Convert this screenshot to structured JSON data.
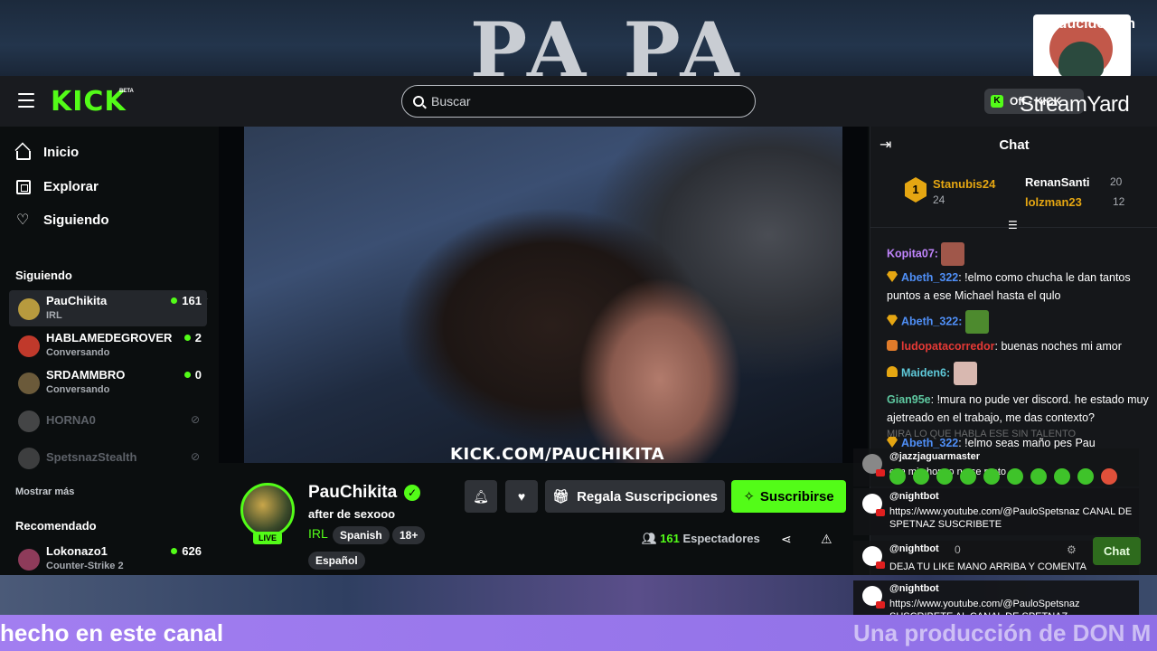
{
  "overlay": {
    "banner_text": "PA PA",
    "produced_by": "Producido con",
    "streamyard_logo": "StreamYard",
    "ticker_left": "hecho en este canal",
    "ticker_right": "Una producción de DON M"
  },
  "header": {
    "logo": "KICK",
    "logo_badge": "BETA",
    "search_placeholder": "Buscar",
    "offkick_label": "Off - KICK"
  },
  "sidebar": {
    "nav": [
      {
        "label": "Inicio",
        "icon": "home-icon"
      },
      {
        "label": "Explorar",
        "icon": "explore-icon"
      },
      {
        "label": "Siguiendo",
        "icon": "heart-icon"
      }
    ],
    "following_heading": "Siguiendo",
    "following": [
      {
        "name": "PauChikita",
        "sub": "IRL",
        "count": "161",
        "avatar_color": "#b79a3e"
      },
      {
        "name": "HABLAMEDEGROVER",
        "sub": "Conversando",
        "count": "2",
        "avatar_color": "#c0392b"
      },
      {
        "name": "SRDAMMBRO",
        "sub": "Conversando",
        "count": "0",
        "avatar_color": "#6b5a3a"
      },
      {
        "name": "HORNA0",
        "avatar_color": "#8a8a8a"
      },
      {
        "name": "SpetsnazStealth",
        "avatar_color": "#7a7a7a"
      }
    ],
    "show_more": "Mostrar más",
    "recommended_heading": "Recomendado",
    "recommended": [
      {
        "name": "Lokonazo1",
        "sub": "Counter-Strike 2",
        "count": "626",
        "avatar_color": "#8e3b5a"
      }
    ]
  },
  "video": {
    "watermark": "KICK.COM/PAUCHIKITA"
  },
  "stream": {
    "streamer": "PauChikita",
    "live": "LIVE",
    "title": "after de sexooo",
    "category": "IRL",
    "tags": [
      "Spanish",
      "18+",
      "Español"
    ],
    "gift_label": "Regala Suscripciones",
    "subscribe_label": "Suscribirse",
    "viewers_count": "161",
    "viewers_label": "Espectadores"
  },
  "chat": {
    "title": "Chat",
    "leaderboard": [
      {
        "rank": "1",
        "name": "Stanubis24",
        "points": "24",
        "color": "#e5a612"
      },
      {
        "name": "RenanSanti",
        "points": "20",
        "color": "#ffffff"
      },
      {
        "name": "lolzman23",
        "points": "12",
        "color": "#e5a612"
      }
    ],
    "messages": [
      {
        "user": "Kopita07:",
        "color": "#c084fc",
        "text": ""
      },
      {
        "user": "Abeth_322",
        "color": "#4f8ff7",
        "text": ": !elmo como chucha le dan tantos puntos a ese Michael hasta el qulo"
      },
      {
        "user": "Abeth_322:",
        "color": "#4f8ff7",
        "text": ""
      },
      {
        "user": "ludopatacorredor",
        "color": "#e53935",
        "text": ": buenas noches mi amor"
      },
      {
        "user": "Maiden6:",
        "color": "#5ec8d8",
        "text": ""
      },
      {
        "user": "Gian95e",
        "color": "#5ec8a0",
        "text": ": !mura no pude ver discord. he estado muy ajetreado en el trabajo, me das contexto?"
      },
      {
        "user": "Abeth_322",
        "color": "#4f8ff7",
        "text": ": !elmo seas maño pes Pau"
      }
    ],
    "faded_line": "MIRA LO QUE HABLA ESE SIN TALENTO",
    "chat_button": "Chat",
    "input_count": "0"
  },
  "overlay_chat": [
    {
      "user": "@jazzjaguarmaster",
      "text": "con mi chongo no se meto"
    },
    {
      "user": "@nightbot",
      "text": "https://www.youtube.com/@PauloSpetsnaz CANAL DE SPETNAZ SUSCRIBETE"
    },
    {
      "user": "@nightbot",
      "text": "DEJA TU LIKE MANO ARRIBA Y COMENTA"
    },
    {
      "user": "@nightbot",
      "text": "https://www.youtube.com/@PauloSpetsnaz SUSCRIBETE AL CANAL DE SPETNAZ"
    }
  ]
}
